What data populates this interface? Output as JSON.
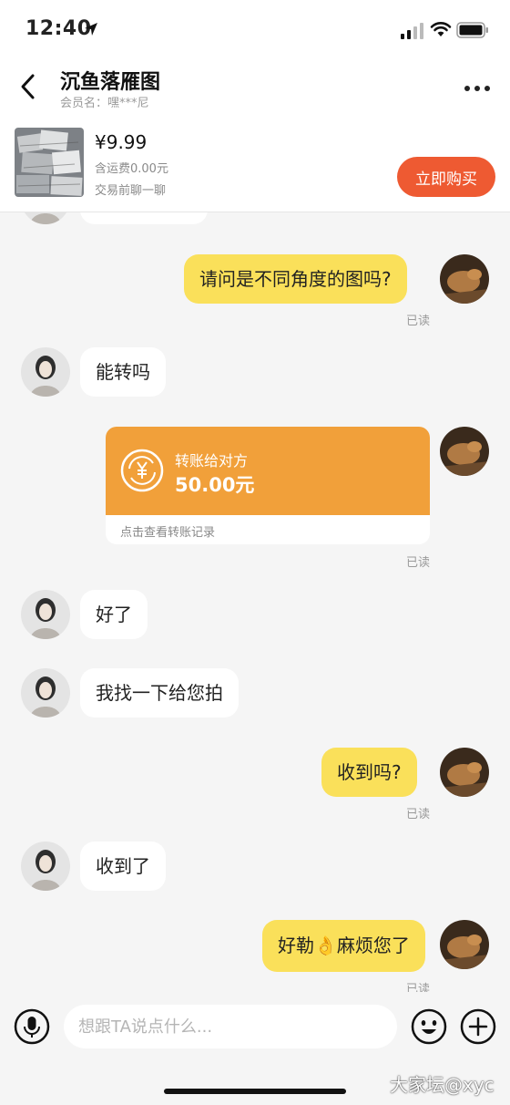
{
  "status_bar": {
    "time": "12:40"
  },
  "header": {
    "title": "沉鱼落雁图",
    "subtitle": "会员名：嘿***尼"
  },
  "product": {
    "price": "¥9.99",
    "shipping": "含运费0.00元",
    "hint": "交易前聊一聊",
    "buy_label": "立即购买"
  },
  "messages": {
    "m1": "请问是不同角度的图吗?",
    "m2": "能转吗",
    "m4": "好了",
    "m5": "我找一下给您拍",
    "m6": "收到吗?",
    "m7": "收到了",
    "m8": "好勒👌麻烦您了"
  },
  "transfer": {
    "label": "转账给对方",
    "amount": "50.00元",
    "footer": "点击查看转账记录"
  },
  "read_label": "已读",
  "input": {
    "placeholder": "想跟TA说点什么..."
  },
  "watermark": "大家坛@xyc",
  "colors": {
    "accent_buy": "#ee5a32",
    "bubble_out": "#fae05a",
    "transfer_card": "#f1a03a"
  }
}
